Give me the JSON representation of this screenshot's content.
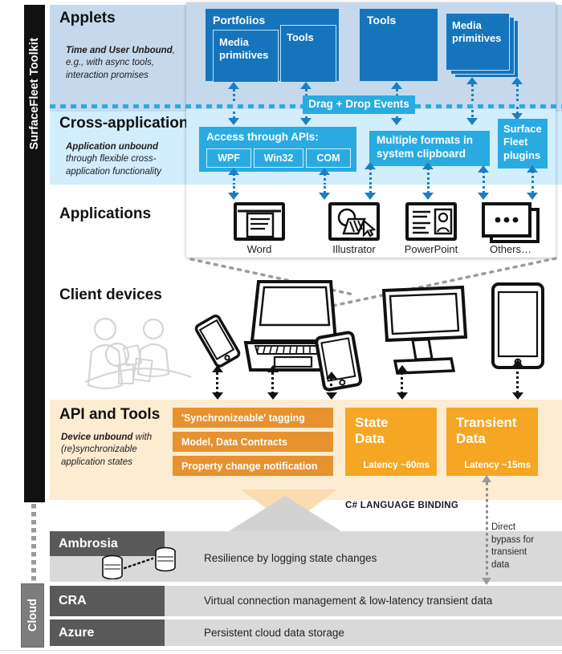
{
  "spine": {
    "toolkit_label": "SurfaceFleet Toolkit",
    "cloud_label": "Cloud"
  },
  "rows": {
    "applets": {
      "title": "Applets",
      "subtitle_bold": "Time and User Unbound",
      "subtitle_rest": ", e.g., with async tools, interaction promises"
    },
    "cross_application": {
      "title": "Cross-application",
      "subtitle_bold": "Application unbound",
      "subtitle_rest": " through flexible cross-application functionality"
    },
    "applications": {
      "title": "Applications"
    },
    "client_devices": {
      "title": "Client devices"
    },
    "api_and_tools": {
      "title": "API and Tools",
      "subtitle_bold": "Device unbound",
      "subtitle_rest": " with (re)synchronizable application states"
    }
  },
  "applets_boxes": {
    "portfolios": "Portfolios",
    "portfolios_media": "Media primitives",
    "portfolios_tools": "Tools",
    "tools": "Tools",
    "media_primitives_stack": "Media primitives"
  },
  "divider": {
    "drag_drop_label": "Drag + Drop Events"
  },
  "cross_boxes": {
    "access_apis": "Access through APIs:",
    "chips": [
      "WPF",
      "Win32",
      "COM"
    ],
    "clipboard": "Multiple formats in system clipboard",
    "plugins": "Surface Fleet plugins"
  },
  "applications": [
    {
      "name": "Word",
      "icon": "document-window-icon"
    },
    {
      "name": "Illustrator",
      "icon": "vector-shapes-icon"
    },
    {
      "name": "PowerPoint",
      "icon": "slide-window-icon"
    },
    {
      "name": "Others…",
      "icon": "ellipsis-window-icon"
    }
  ],
  "devices": [
    {
      "name": "phone-tilted-icon"
    },
    {
      "name": "laptop-icon"
    },
    {
      "name": "tablet-icon"
    },
    {
      "name": "monitor-icon"
    },
    {
      "name": "tablet-large-icon"
    }
  ],
  "api_boxes": [
    "'Synchronizeable' tagging",
    "Model, Data Contracts",
    "Property change notification"
  ],
  "data_boxes": [
    {
      "title": "State Data",
      "line1": "State",
      "line2": "Data",
      "latency": "Latency ~60ms"
    },
    {
      "title": "Transient Data",
      "line1": "Transient",
      "line2": "Data",
      "latency": "Latency ~15ms"
    }
  ],
  "binding_label": "C# LANGUAGE BINDING",
  "cloud_rows": [
    {
      "tag": "Ambrosia",
      "text": "Resilience by logging state changes"
    },
    {
      "tag": "CRA",
      "text": "Virtual connection management & low-latency transient data"
    },
    {
      "tag": "Azure",
      "text": "Persistent cloud data storage"
    }
  ],
  "bypass_note": "Direct bypass for transient data",
  "colors": {
    "applets_bg": "#c6d9ec",
    "cross_bg": "#d2edfb",
    "api_bg": "#fdecd2",
    "deep_blue": "#1674bd",
    "light_blue": "#29abe2",
    "orange": "#e8912f",
    "amber": "#f5a623",
    "cloud_tag": "#595959",
    "cloud_row": "#d9d9d9"
  }
}
